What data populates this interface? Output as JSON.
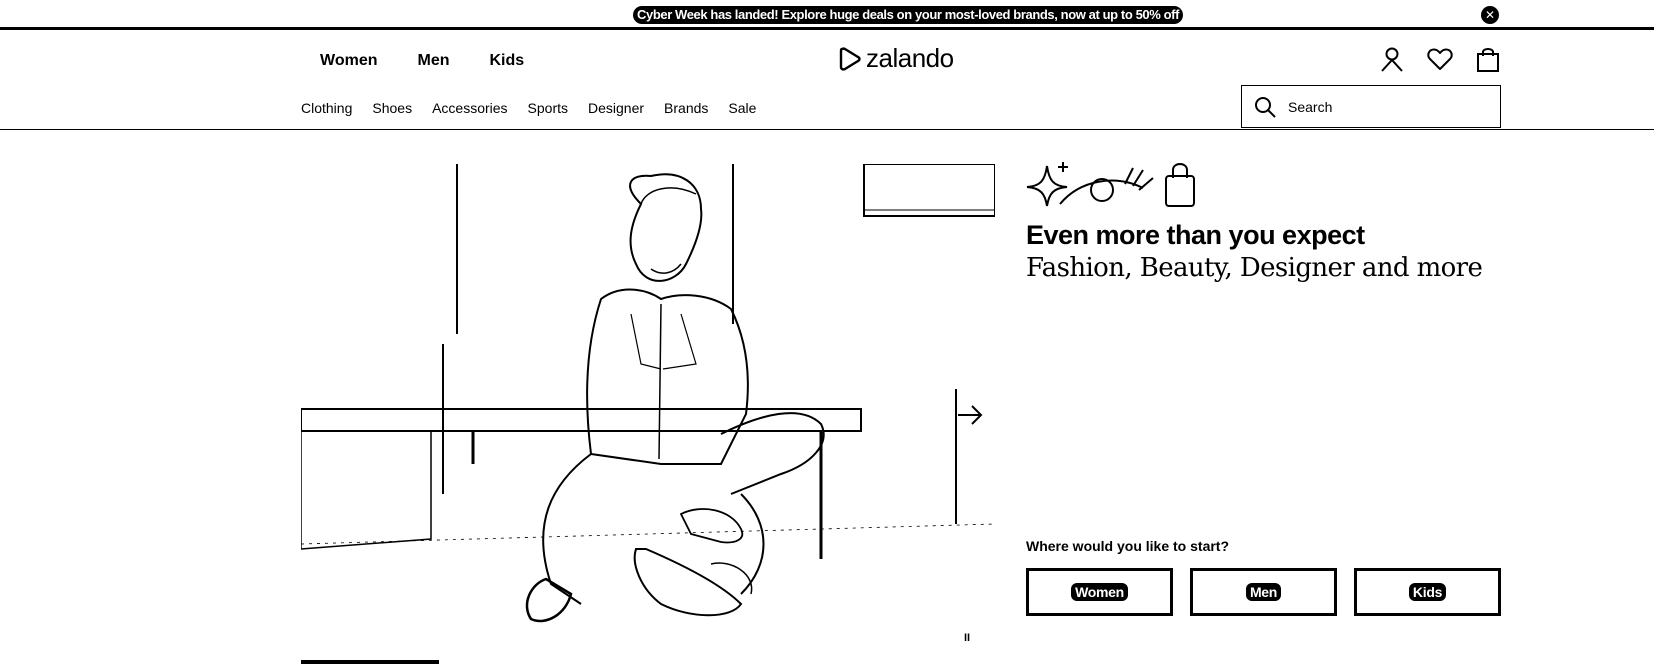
{
  "promo": {
    "text": "Cyber Week has landed! Explore huge deals on your most-loved brands, now at up to 50% off"
  },
  "header": {
    "primary_nav": [
      "Women",
      "Men",
      "Kids"
    ],
    "logo_text": "zalando",
    "secondary_nav": [
      "Clothing",
      "Shoes",
      "Accessories",
      "Sports",
      "Designer",
      "Brands",
      "Sale"
    ],
    "search_placeholder": "Search",
    "icons": [
      "user-icon",
      "heart-icon",
      "bag-icon"
    ]
  },
  "hero": {
    "headline": "Even more than you expect",
    "subline": "Fashion, Beauty, Designer and more",
    "start_question": "Where would you like to start?",
    "start_buttons": [
      "Women",
      "Men",
      "Kids"
    ],
    "pause_label": "II"
  }
}
